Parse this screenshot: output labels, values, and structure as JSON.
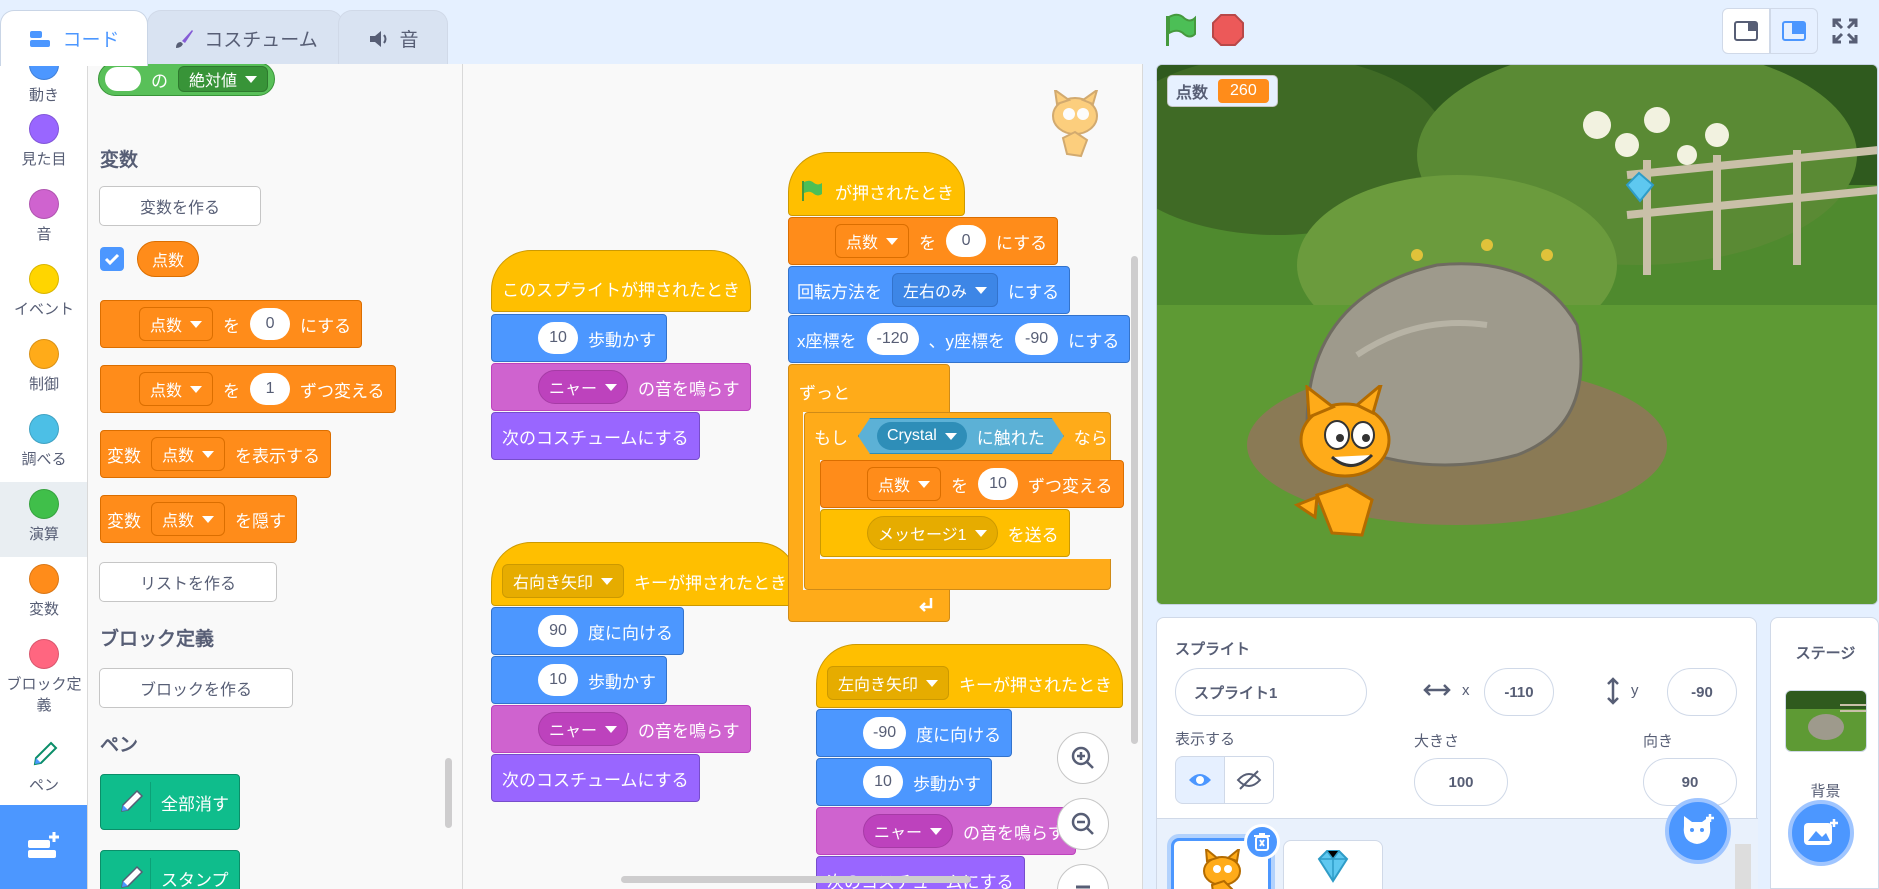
{
  "tabs": {
    "code": "コード",
    "costume": "コスチューム",
    "sound": "音"
  },
  "categories": {
    "motion": "動き",
    "looks": "見た目",
    "sound": "音",
    "events": "イベント",
    "control": "制御",
    "sensing": "調べる",
    "operators": "演算",
    "variables": "変数",
    "myblocks": "ブロック定義",
    "pen": "ペン"
  },
  "palette": {
    "abs_of": "の",
    "abs_dd": "絶対値",
    "variables_heading": "変数",
    "make_variable": "変数を作る",
    "var_name": "点数",
    "set_var": {
      "var": "点数",
      "to": "を",
      "value": "0",
      "suffix": "にする"
    },
    "change_var": {
      "var": "点数",
      "by": "を",
      "value": "1",
      "suffix": "ずつ変える"
    },
    "show_var": {
      "prefix": "変数",
      "var": "点数",
      "suffix": "を表示する"
    },
    "hide_var": {
      "prefix": "変数",
      "var": "点数",
      "suffix": "を隠す"
    },
    "make_list": "リストを作る",
    "myblocks_heading": "ブロック定義",
    "make_block": "ブロックを作る",
    "pen_heading": "ペン",
    "pen_clear": "全部消す",
    "pen_stamp": "スタンプ"
  },
  "scripts": {
    "s1": {
      "hat": "このスプライトが押されたとき",
      "move_val": "10",
      "move": "歩動かす",
      "sound_dd": "ニャー",
      "sound": "の音を鳴らす",
      "next_costume": "次のコスチュームにする"
    },
    "s2": {
      "hat_key": "右向き矢印",
      "hat": "キーが押されたとき",
      "dir_val": "90",
      "dir": "度に向ける",
      "move_val": "10",
      "move": "歩動かす",
      "sound_dd": "ニャー",
      "sound": "の音を鳴らす",
      "next_costume": "次のコスチュームにする"
    },
    "s3": {
      "hat": "が押されたとき",
      "set_var": "点数",
      "set_to": "を",
      "set_val": "0",
      "set_suffix": "にする",
      "rot": "回転方法を",
      "rot_dd": "左右のみ",
      "rot_suffix": "にする",
      "goto_x": "x座標を",
      "x_val": "-120",
      "goto_y": "、y座標を",
      "y_val": "-90",
      "goto_suffix": "にする",
      "forever": "ずっと",
      "if": "もし",
      "touch_dd": "Crystal",
      "touching": "に触れた",
      "then": "なら",
      "change_var": "点数",
      "change_by": "を",
      "change_val": "10",
      "change_suffix": "ずつ変える",
      "broadcast_dd": "メッセージ1",
      "broadcast": "を送る"
    },
    "s4": {
      "hat_key": "左向き矢印",
      "hat": "キーが押されたとき",
      "dir_val": "-90",
      "dir": "度に向ける",
      "move_val": "10",
      "move": "歩動かす",
      "sound_dd": "ニャー",
      "sound": "の音を鳴らす",
      "next_costume": "次のコスチュームにする"
    }
  },
  "stage": {
    "monitor_label": "点数",
    "monitor_value": "260"
  },
  "sprite_info": {
    "title": "スプライト",
    "name": "スプライト1",
    "x_label": "x",
    "x": "-110",
    "y_label": "y",
    "y": "-90",
    "show_label": "表示する",
    "size_label": "大きさ",
    "size": "100",
    "direction_label": "向き",
    "direction": "90"
  },
  "stage_panel": {
    "title": "ステージ",
    "backdrop_label": "背景"
  },
  "colors": {
    "accent": "#4c97ff",
    "motion": "#4c97ff",
    "looks": "#9966ff",
    "sound": "#cf63cf",
    "events": "#ffbf00",
    "control": "#ffab19",
    "sensing": "#5cb1d6",
    "operators": "#59c059",
    "variables": "#ff8c1a",
    "myblocks": "#ff6680",
    "pen": "#0fbd8c"
  }
}
